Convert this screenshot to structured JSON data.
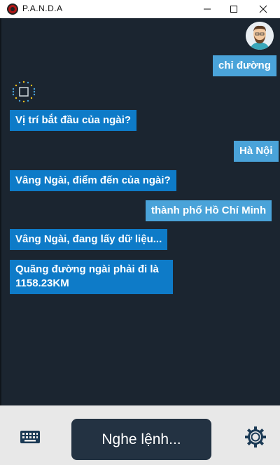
{
  "window": {
    "title": "P.A.N.D.A",
    "icons": [
      "app-logo-icon",
      "minimize-icon",
      "maximize-icon",
      "close-icon"
    ]
  },
  "chat": {
    "messages": [
      {
        "sender": "user",
        "text": "chỉ đường"
      },
      {
        "sender": "bot",
        "text": "Vị trí bắt đầu của ngài?"
      },
      {
        "sender": "user",
        "text": "Hà Nội"
      },
      {
        "sender": "bot",
        "text": "Vâng Ngài, điểm đến của ngài?"
      },
      {
        "sender": "user",
        "text": "thành phố Hồ Chí Minh"
      },
      {
        "sender": "bot",
        "text": "Vâng Ngài, đang lấy dữ liệu..."
      },
      {
        "sender": "bot",
        "text_line1": "Quãng đường ngài phải đi là",
        "text_line2": "1158.23KM"
      }
    ],
    "colors": {
      "user_bubble": "#4aa3d9",
      "bot_bubble": "#0e7bc8",
      "background": "#1b2530"
    }
  },
  "bottom": {
    "listen_label": "Nghe lệnh...",
    "icons": [
      "keyboard-icon",
      "settings-gear-icon"
    ]
  }
}
